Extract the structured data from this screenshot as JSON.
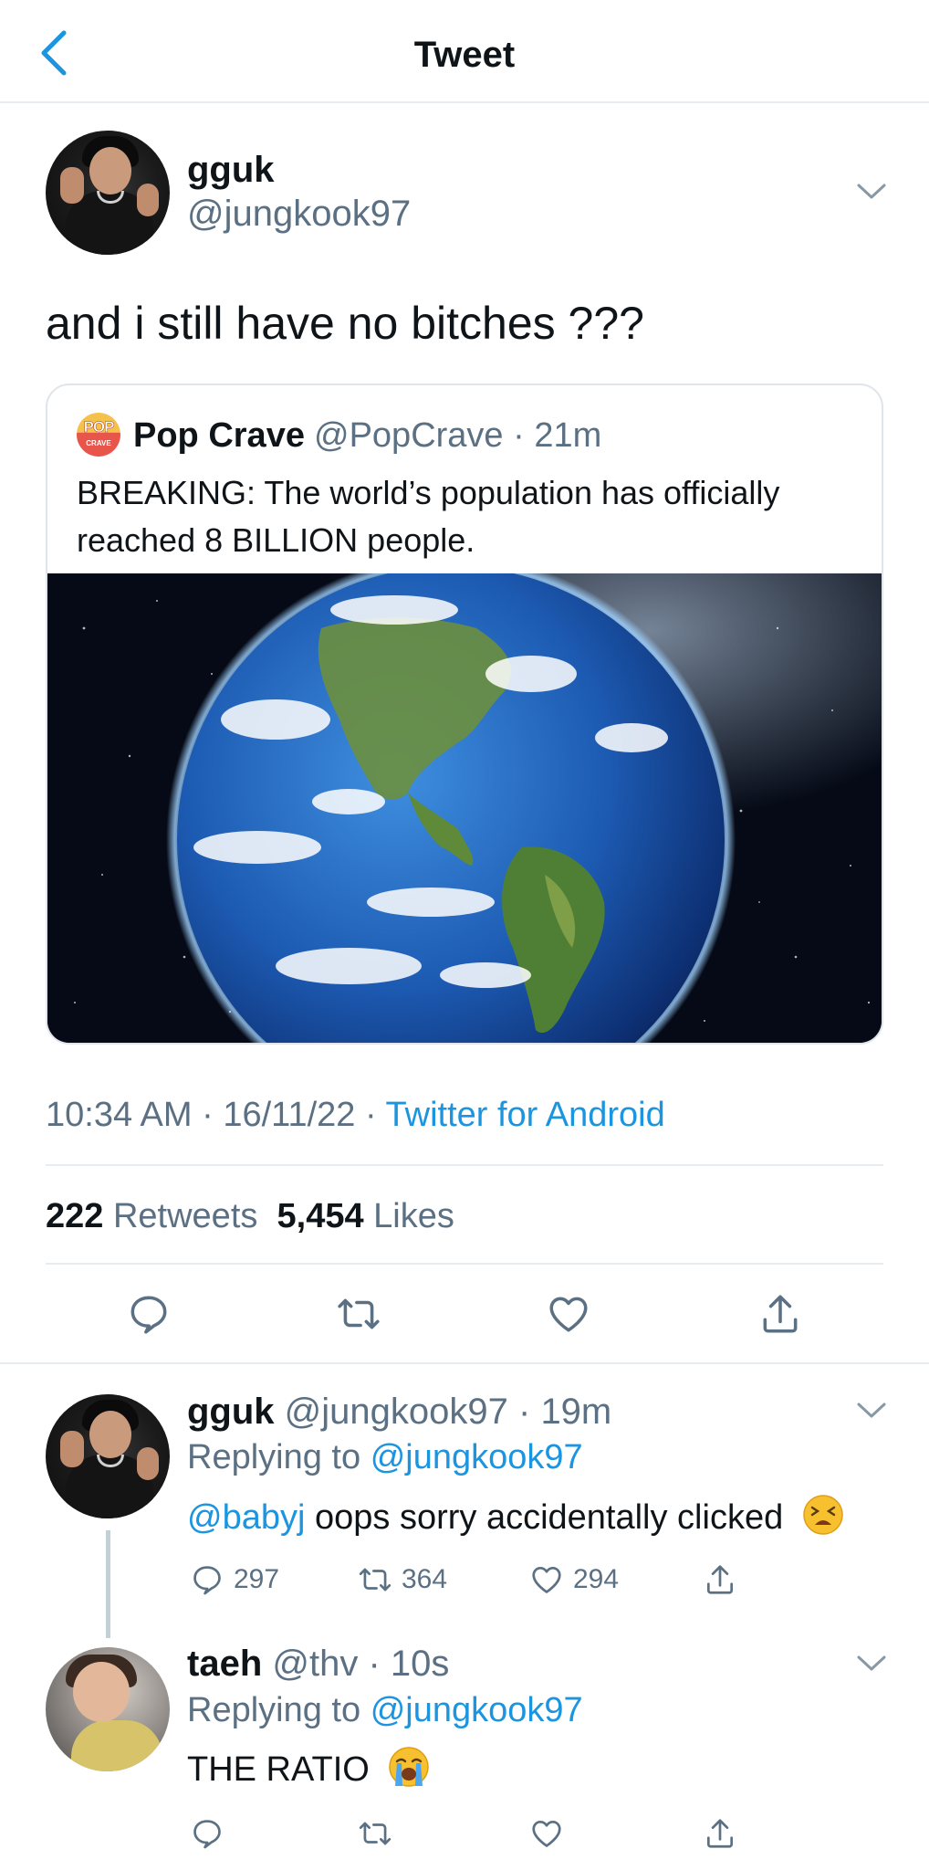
{
  "header": {
    "title": "Tweet",
    "back_icon": "chevron-left-icon"
  },
  "main_tweet": {
    "author_name": "gguk",
    "author_handle": "@jungkook97",
    "text": "and i still have no bitches ???",
    "quote": {
      "logo_text_top": "POP",
      "logo_text_bottom": "CRAVE",
      "author_name": "Pop Crave",
      "author_handle": "@PopCrave",
      "time": "21m",
      "text": "BREAKING: The world’s population has officially reached 8 BILLION people."
    },
    "timestamp": "10:34 AM · 16/11/22 ·",
    "source": "Twitter for Android",
    "retweet_count": "222",
    "retweet_label": "Retweets",
    "like_count": "5,454",
    "like_label": "Likes"
  },
  "replies": [
    {
      "author_name": "gguk",
      "author_handle": "@jungkook97",
      "time": "19m",
      "replying_label": "Replying to",
      "replying_to": "@jungkook97",
      "mention": "@babyj",
      "text": "oops sorry accidentally clicked",
      "emoji": "tired-face-emoji",
      "reply_count": "297",
      "retweet_count": "364",
      "like_count": "294"
    },
    {
      "author_name": "taeh",
      "author_handle": "@thv",
      "time": "10s",
      "replying_label": "Replying to",
      "replying_to": "@jungkook97",
      "text": "THE RATIO",
      "emoji": "loudly-crying-face-emoji"
    }
  ],
  "colors": {
    "accent": "#1b95e0",
    "secondary_text": "#5b7083",
    "divider": "#e6ecf0"
  }
}
